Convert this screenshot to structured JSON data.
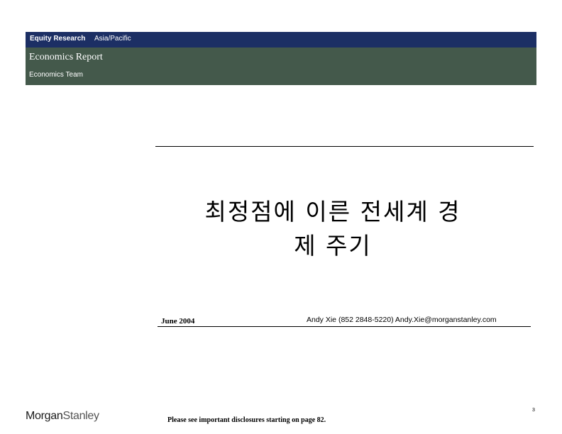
{
  "header": {
    "department": "Equity Research",
    "region": "Asia/Pacific",
    "report_type": "Economics Report",
    "team": "Economics Team"
  },
  "title": {
    "line1": "최정점에 이른 전세계 경",
    "line2": "제 주기"
  },
  "meta": {
    "date": "June 2004",
    "author": "Andy Xie  (852 2848-5220)  Andy.Xie@morganstanley.com"
  },
  "footer": {
    "logo_part1": "Morgan",
    "logo_part2": "Stanley",
    "page_number": "3",
    "disclaimer": "Please see important disclosures starting on page 82."
  },
  "colors": {
    "header_navy": "#1c2f64",
    "header_green": "#44594b"
  }
}
